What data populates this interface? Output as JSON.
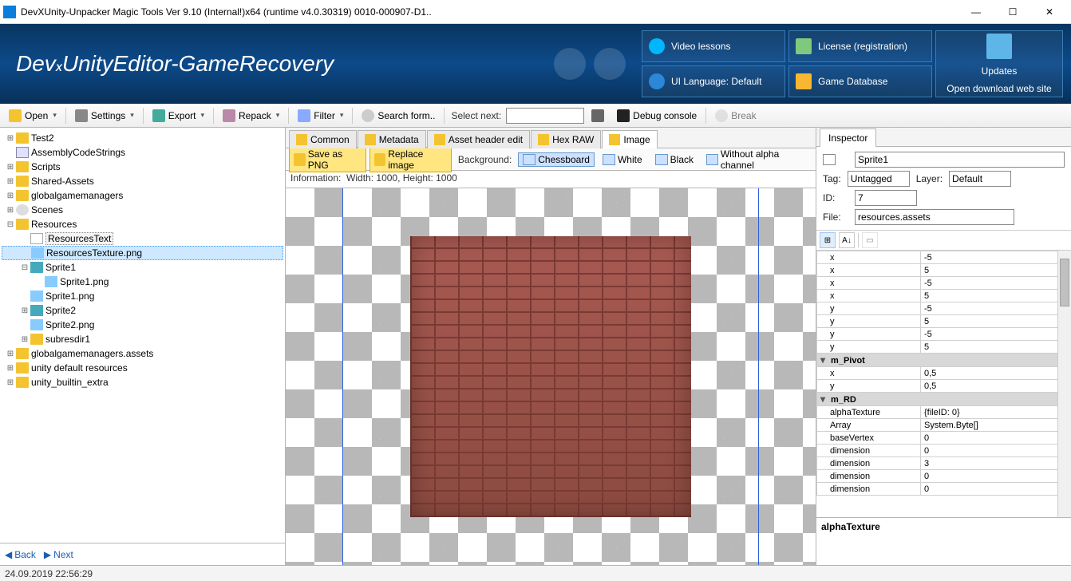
{
  "window": {
    "title": "DevXUnity-Unpacker Magic Tools Ver 9.10 (Internal!)x64 (runtime v4.0.30319) 0010-000907-D1.."
  },
  "banner": {
    "logo_html": "DevXUnityEditor-GameRecovery",
    "buttons": {
      "video": "Video lessons",
      "license": "License (registration)",
      "language": "UI Language: Default",
      "database": "Game Database",
      "updates_title": "Updates",
      "updates_sub": "Open download web site"
    }
  },
  "toolbar": {
    "open": "Open",
    "settings": "Settings",
    "export": "Export",
    "repack": "Repack",
    "filter": "Filter",
    "search": "Search form..",
    "select_next": "Select next:",
    "debug": "Debug console",
    "break": "Break"
  },
  "tree": {
    "items": [
      {
        "d": 0,
        "t": "+",
        "i": "folder",
        "l": "Test2"
      },
      {
        "d": 0,
        "t": " ",
        "i": "script",
        "l": "AssemblyCodeStrings"
      },
      {
        "d": 0,
        "t": "+",
        "i": "folder",
        "l": "Scripts"
      },
      {
        "d": 0,
        "t": "+",
        "i": "folder",
        "l": "Shared-Assets"
      },
      {
        "d": 0,
        "t": "+",
        "i": "folder",
        "l": "globalgamemanagers"
      },
      {
        "d": 0,
        "t": "+",
        "i": "scene",
        "l": "Scenes"
      },
      {
        "d": 0,
        "t": "-",
        "i": "folder",
        "l": "Resources"
      },
      {
        "d": 1,
        "t": " ",
        "i": "file",
        "l": "ResourcesText",
        "sel": false,
        "box": true
      },
      {
        "d": 1,
        "t": " ",
        "i": "img",
        "l": "ResourcesTexture.png",
        "sel": true
      },
      {
        "d": 1,
        "t": "-",
        "i": "sprite",
        "l": "Sprite1"
      },
      {
        "d": 2,
        "t": " ",
        "i": "img",
        "l": "Sprite1.png"
      },
      {
        "d": 1,
        "t": " ",
        "i": "img",
        "l": "Sprite1.png"
      },
      {
        "d": 1,
        "t": "+",
        "i": "sprite",
        "l": "Sprite2"
      },
      {
        "d": 1,
        "t": " ",
        "i": "img",
        "l": "Sprite2.png"
      },
      {
        "d": 1,
        "t": "+",
        "i": "folder",
        "l": "subresdir1"
      },
      {
        "d": 0,
        "t": "+",
        "i": "folder",
        "l": "globalgamemanagers.assets"
      },
      {
        "d": 0,
        "t": "+",
        "i": "folder",
        "l": "unity default resources"
      },
      {
        "d": 0,
        "t": "+",
        "i": "folder",
        "l": "unity_builtin_extra"
      }
    ],
    "back": "Back",
    "next": "Next"
  },
  "viewer": {
    "tabs": [
      "Common",
      "Metadata",
      "Asset header edit",
      "Hex RAW",
      "Image"
    ],
    "active_tab": 4,
    "save_png": "Save as PNG",
    "replace": "Replace image",
    "bg_label": "Background:",
    "bg_options": [
      "Chessboard",
      "White",
      "Black",
      "Without alpha channel"
    ],
    "info_label": "Information:",
    "info_text": "Width: 1000, Height: 1000"
  },
  "inspector": {
    "tab": "Inspector",
    "name": "Sprite1",
    "tag_label": "Tag:",
    "tag": "Untagged",
    "layer_label": "Layer:",
    "layer": "Default",
    "id_label": "ID:",
    "id": "7",
    "file_label": "File:",
    "file": "resources.assets",
    "props": [
      {
        "k": "x",
        "v": "-5"
      },
      {
        "k": "x",
        "v": "5"
      },
      {
        "k": "x",
        "v": "-5"
      },
      {
        "k": "x",
        "v": "5"
      },
      {
        "k": "y",
        "v": "-5"
      },
      {
        "k": "y",
        "v": "5"
      },
      {
        "k": "y",
        "v": "-5"
      },
      {
        "k": "y",
        "v": "5"
      },
      {
        "cat": "m_Pivot"
      },
      {
        "k": "x",
        "v": "0,5"
      },
      {
        "k": "y",
        "v": "0,5"
      },
      {
        "cat": "m_RD"
      },
      {
        "k": "alphaTexture",
        "v": "{fileID: 0}"
      },
      {
        "k": "Array",
        "v": "System.Byte[]"
      },
      {
        "k": "baseVertex",
        "v": "0"
      },
      {
        "k": "dimension",
        "v": "0"
      },
      {
        "k": "dimension",
        "v": "3"
      },
      {
        "k": "dimension",
        "v": "0"
      },
      {
        "k": "dimension",
        "v": "0"
      }
    ],
    "desc_title": "alphaTexture"
  },
  "status": {
    "time": "24.09.2019 22:56:29"
  }
}
